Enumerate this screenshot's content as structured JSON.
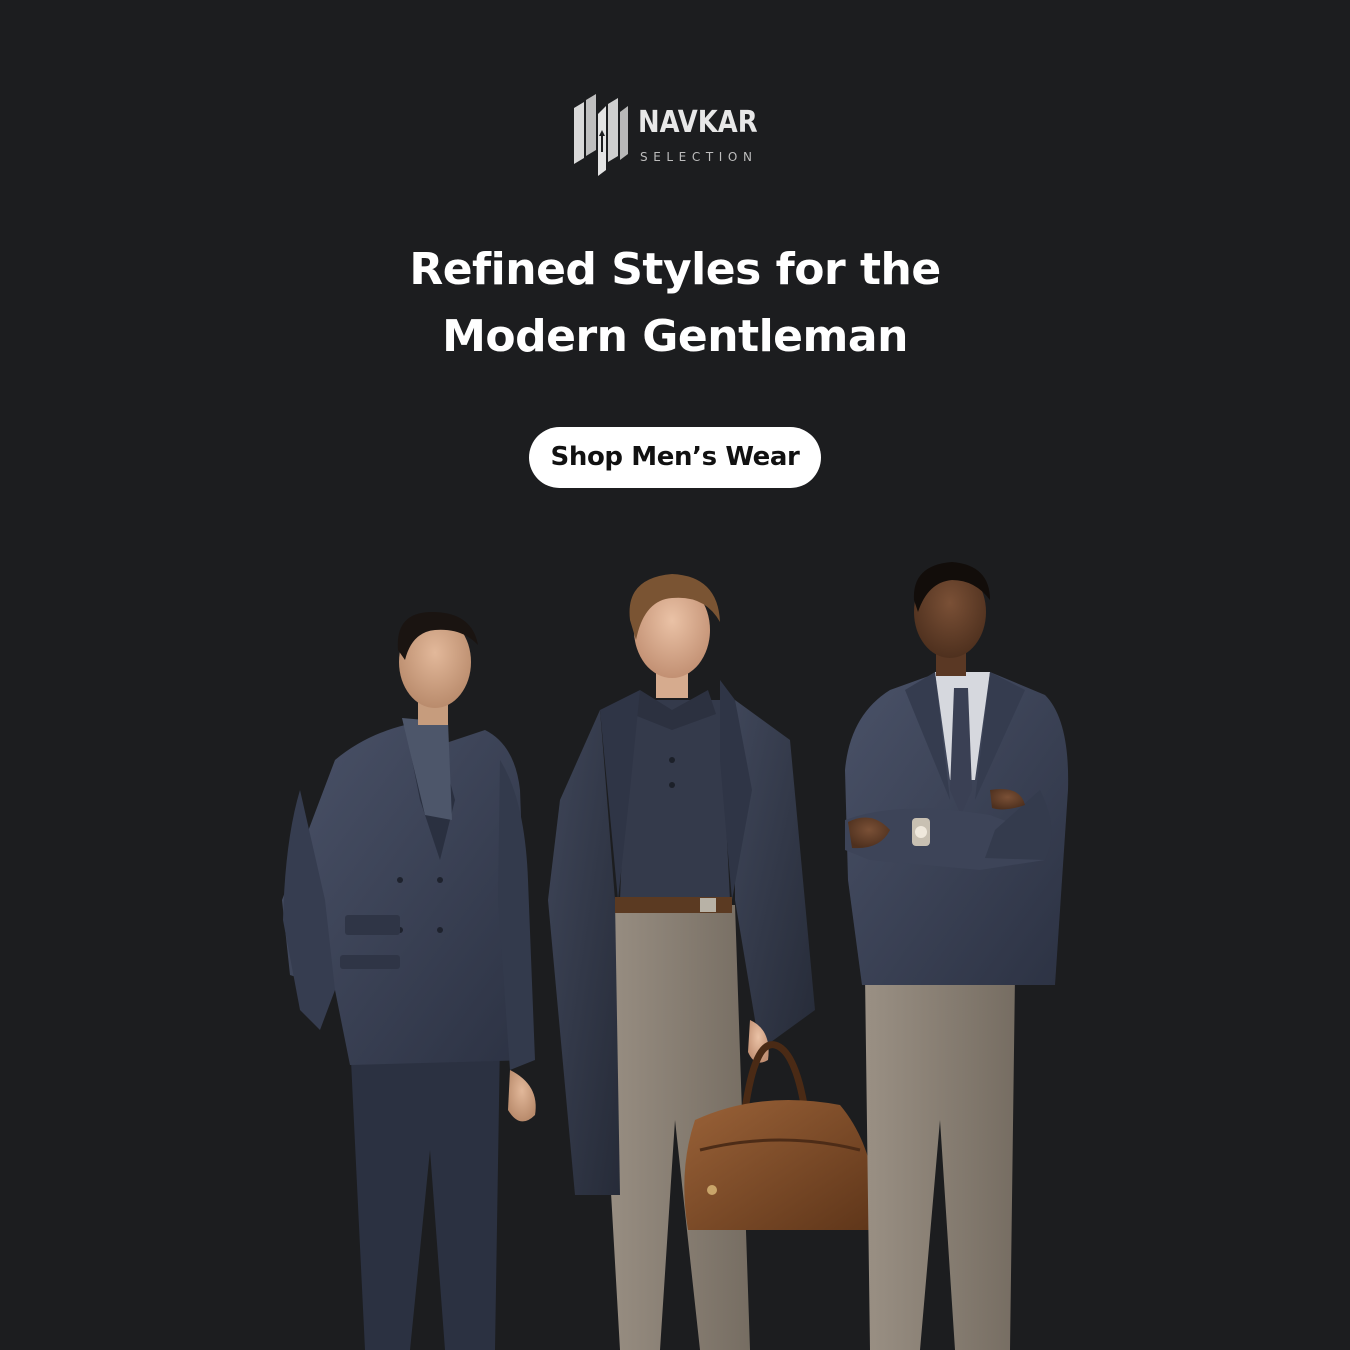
{
  "brand": {
    "name": "NAVKAR",
    "subtitle": "SELECTION"
  },
  "hero": {
    "headline_line1": "Refined Styles for the",
    "headline_line2": "Modern Gentleman",
    "cta_label": "Shop Men’s Wear",
    "image_alt": "Three men in navy suits and coats with grey trousers, one holding a brown leather duffle bag"
  },
  "colors": {
    "background": "#1c1d1f",
    "headline_text": "#ffffff",
    "cta_background": "#ffffff",
    "cta_text": "#111111",
    "suit_navy": "#3a4153",
    "trouser_taupe": "#8b8174",
    "bag_brown": "#7a4a2c"
  }
}
